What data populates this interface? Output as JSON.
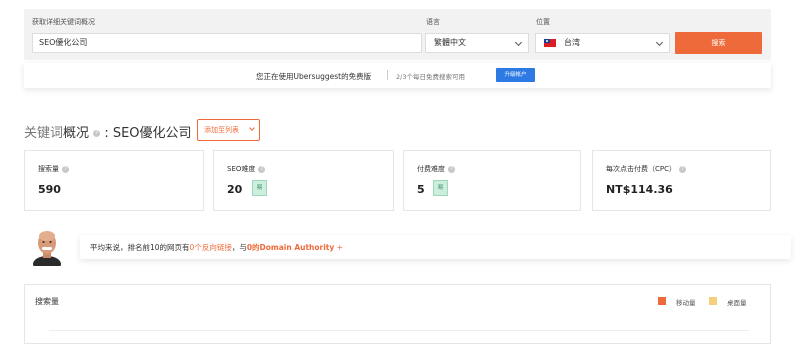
{
  "search": {
    "keyword_label": "获取详细关键词概况",
    "keyword_value": "SEO優化公司",
    "language_label": "语言",
    "language_value": "繁體中文",
    "location_label": "位置",
    "location_value": "台湾",
    "search_button": "搜索"
  },
  "notice": {
    "text": "您正在使用Ubersuggest的免费版",
    "quota": "2/3个每日免费搜索可用",
    "upgrade_button": "升级帐户"
  },
  "overview": {
    "title_prefix": "关键词",
    "title_main": "概况",
    "title_suffix": ": SEO優化公司",
    "add_to_list": "添加至列表"
  },
  "metrics": [
    {
      "label": "搜索量",
      "value": "590",
      "badge": ""
    },
    {
      "label": "SEO难度",
      "value": "20",
      "badge": "易"
    },
    {
      "label": "付费难度",
      "value": "5",
      "badge": "易"
    },
    {
      "label": "每次点击付费（CPC）",
      "value": "NT$114.36",
      "badge": ""
    }
  ],
  "authority": {
    "text1": "平均来说，排名前10的网页有",
    "backlinks": "0个反向链接",
    "text2": "，与",
    "da": "0的Domain Authority",
    "plus": " +"
  },
  "volume_chart": {
    "title": "搜索量",
    "legend_mobile": "移动量",
    "legend_desktop": "桌面量",
    "color_mobile": "#ef6a3a",
    "color_desktop": "#f5cf7a"
  },
  "colors": {
    "accent": "#ef6a3a",
    "upgrade": "#2d7ae5",
    "easy_badge": "#cdeedd"
  }
}
